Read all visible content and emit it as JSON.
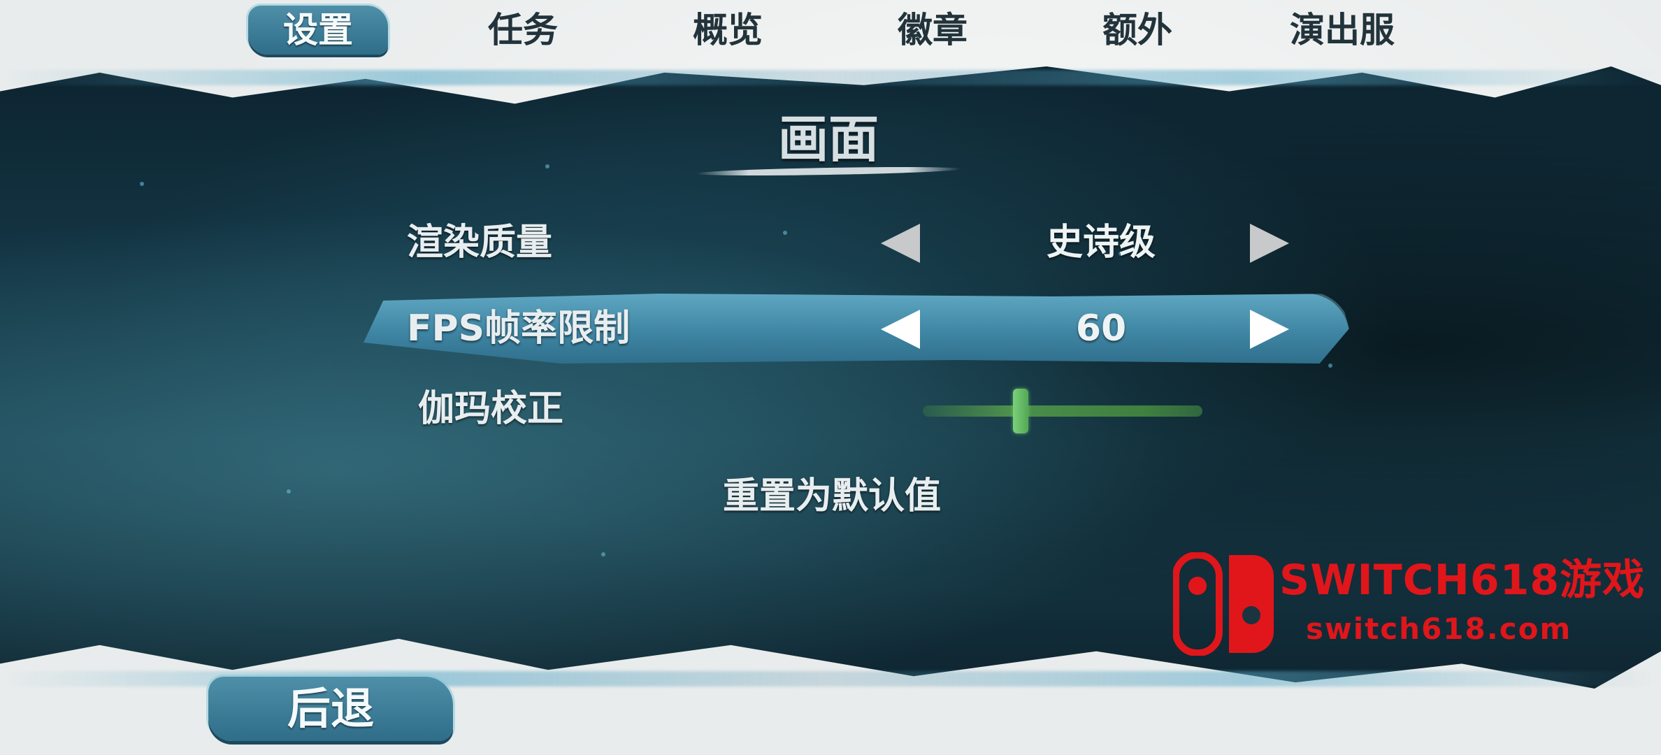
{
  "tabs": [
    {
      "label": "设置",
      "active": true
    },
    {
      "label": "任务"
    },
    {
      "label": "概览"
    },
    {
      "label": "徽章"
    },
    {
      "label": "额外"
    },
    {
      "label": "演出服"
    }
  ],
  "section_title": "画面",
  "settings": {
    "render_quality": {
      "label": "渲染质量",
      "value": "史诗级"
    },
    "fps_limit": {
      "label": "FPS帧率限制",
      "value": "60"
    },
    "gamma": {
      "label": "伽玛校正",
      "level": 0.35
    }
  },
  "reset_label": "重置为默认值",
  "back_label": "后退",
  "watermark": {
    "title": "SWITCH618游戏",
    "url": "switch618.com"
  },
  "colors": {
    "ink": "#143746",
    "highlight": "#3f86a4",
    "slider": "#54a855",
    "watermark": "#e0161b"
  }
}
